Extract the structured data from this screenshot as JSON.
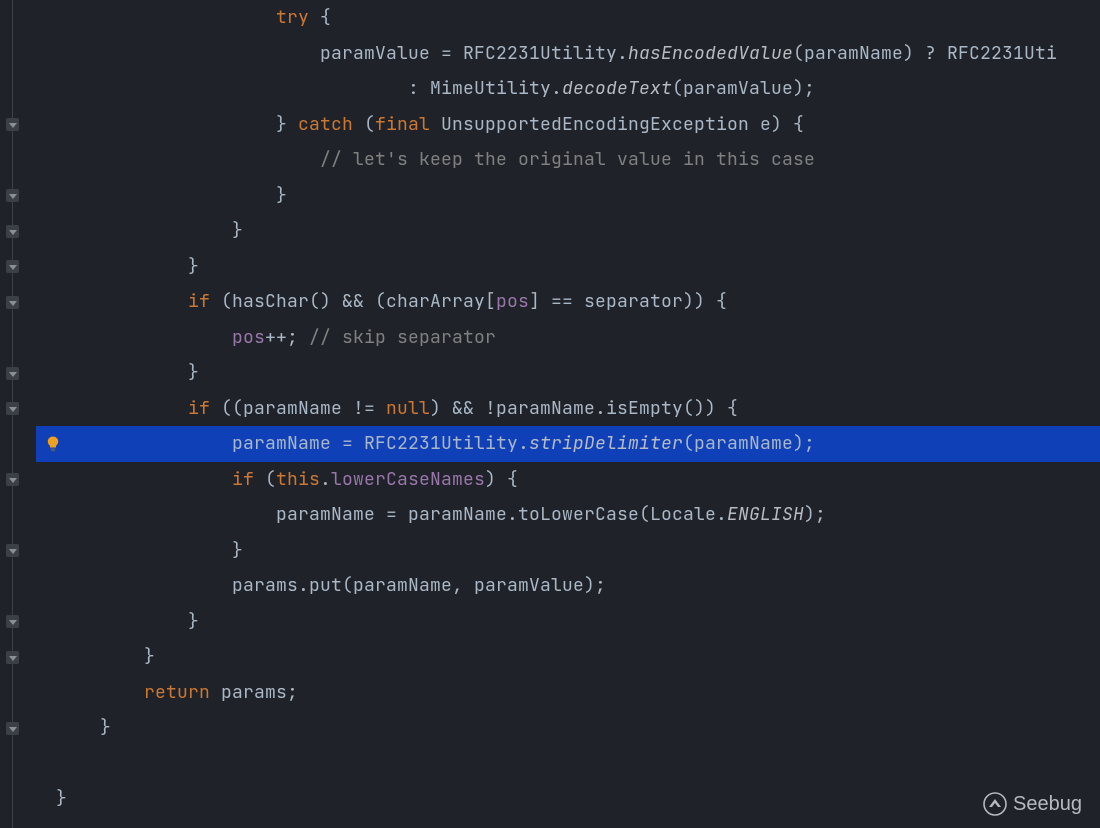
{
  "watermark": {
    "text": "Seebug"
  },
  "highlight_index": 12,
  "code": {
    "lines": [
      [
        {
          "cls": "txt",
          "t": "                    "
        },
        {
          "cls": "kw",
          "t": "try"
        },
        {
          "cls": "txt",
          "t": " {"
        }
      ],
      [
        {
          "cls": "txt",
          "t": "                        paramValue = RFC2231Utility."
        },
        {
          "cls": "sti",
          "t": "hasEncodedValue"
        },
        {
          "cls": "txt",
          "t": "(paramName) ? RFC2231Uti"
        }
      ],
      [
        {
          "cls": "txt",
          "t": "                                : MimeUtility."
        },
        {
          "cls": "sti",
          "t": "decodeText"
        },
        {
          "cls": "txt",
          "t": "(paramValue);"
        }
      ],
      [
        {
          "cls": "txt",
          "t": "                    } "
        },
        {
          "cls": "kw",
          "t": "catch"
        },
        {
          "cls": "txt",
          "t": " ("
        },
        {
          "cls": "kw",
          "t": "final"
        },
        {
          "cls": "txt",
          "t": " UnsupportedEncodingException e) {"
        }
      ],
      [
        {
          "cls": "txt",
          "t": "                        "
        },
        {
          "cls": "cmt",
          "t": "// let's keep the original value in this case"
        }
      ],
      [
        {
          "cls": "txt",
          "t": "                    }"
        }
      ],
      [
        {
          "cls": "txt",
          "t": "                }"
        }
      ],
      [
        {
          "cls": "txt",
          "t": "            }"
        }
      ],
      [
        {
          "cls": "txt",
          "t": "            "
        },
        {
          "cls": "kw",
          "t": "if"
        },
        {
          "cls": "txt",
          "t": " (hasChar() && (charArray["
        },
        {
          "cls": "fld",
          "t": "pos"
        },
        {
          "cls": "txt",
          "t": "] == separator)) {"
        }
      ],
      [
        {
          "cls": "txt",
          "t": "                "
        },
        {
          "cls": "fld",
          "t": "pos"
        },
        {
          "cls": "txt",
          "t": "++; "
        },
        {
          "cls": "cmt",
          "t": "// skip separator"
        }
      ],
      [
        {
          "cls": "txt",
          "t": "            }"
        }
      ],
      [
        {
          "cls": "txt",
          "t": "            "
        },
        {
          "cls": "kw",
          "t": "if"
        },
        {
          "cls": "txt",
          "t": " ((paramName != "
        },
        {
          "cls": "kw",
          "t": "null"
        },
        {
          "cls": "txt",
          "t": ") && !paramName.isEmpty()) {"
        }
      ],
      [
        {
          "cls": "txt",
          "t": "                paramName = RFC2231Utility."
        },
        {
          "cls": "sti",
          "t": "stripDelimiter"
        },
        {
          "cls": "txt",
          "t": "(paramName);"
        }
      ],
      [
        {
          "cls": "txt",
          "t": "                "
        },
        {
          "cls": "kw",
          "t": "if"
        },
        {
          "cls": "txt",
          "t": " ("
        },
        {
          "cls": "kw",
          "t": "this"
        },
        {
          "cls": "txt",
          "t": "."
        },
        {
          "cls": "fld",
          "t": "lowerCaseNames"
        },
        {
          "cls": "txt",
          "t": ") {"
        }
      ],
      [
        {
          "cls": "txt",
          "t": "                    paramName = paramName.toLowerCase(Locale."
        },
        {
          "cls": "sti",
          "t": "ENGLISH"
        },
        {
          "cls": "txt",
          "t": ");"
        }
      ],
      [
        {
          "cls": "txt",
          "t": "                }"
        }
      ],
      [
        {
          "cls": "txt",
          "t": "                params.put(paramName, paramValue);"
        }
      ],
      [
        {
          "cls": "txt",
          "t": "            }"
        }
      ],
      [
        {
          "cls": "txt",
          "t": "        }"
        }
      ],
      [
        {
          "cls": "txt",
          "t": "        "
        },
        {
          "cls": "kw",
          "t": "return"
        },
        {
          "cls": "txt",
          "t": " params;"
        }
      ],
      [
        {
          "cls": "txt",
          "t": "    }"
        }
      ],
      [
        {
          "cls": "txt",
          "t": " "
        }
      ],
      [
        {
          "cls": "txt",
          "t": "}"
        }
      ]
    ]
  },
  "fold_markers_rows": [
    3,
    5,
    6,
    7,
    8,
    10,
    11,
    13,
    15,
    17,
    18,
    20
  ]
}
